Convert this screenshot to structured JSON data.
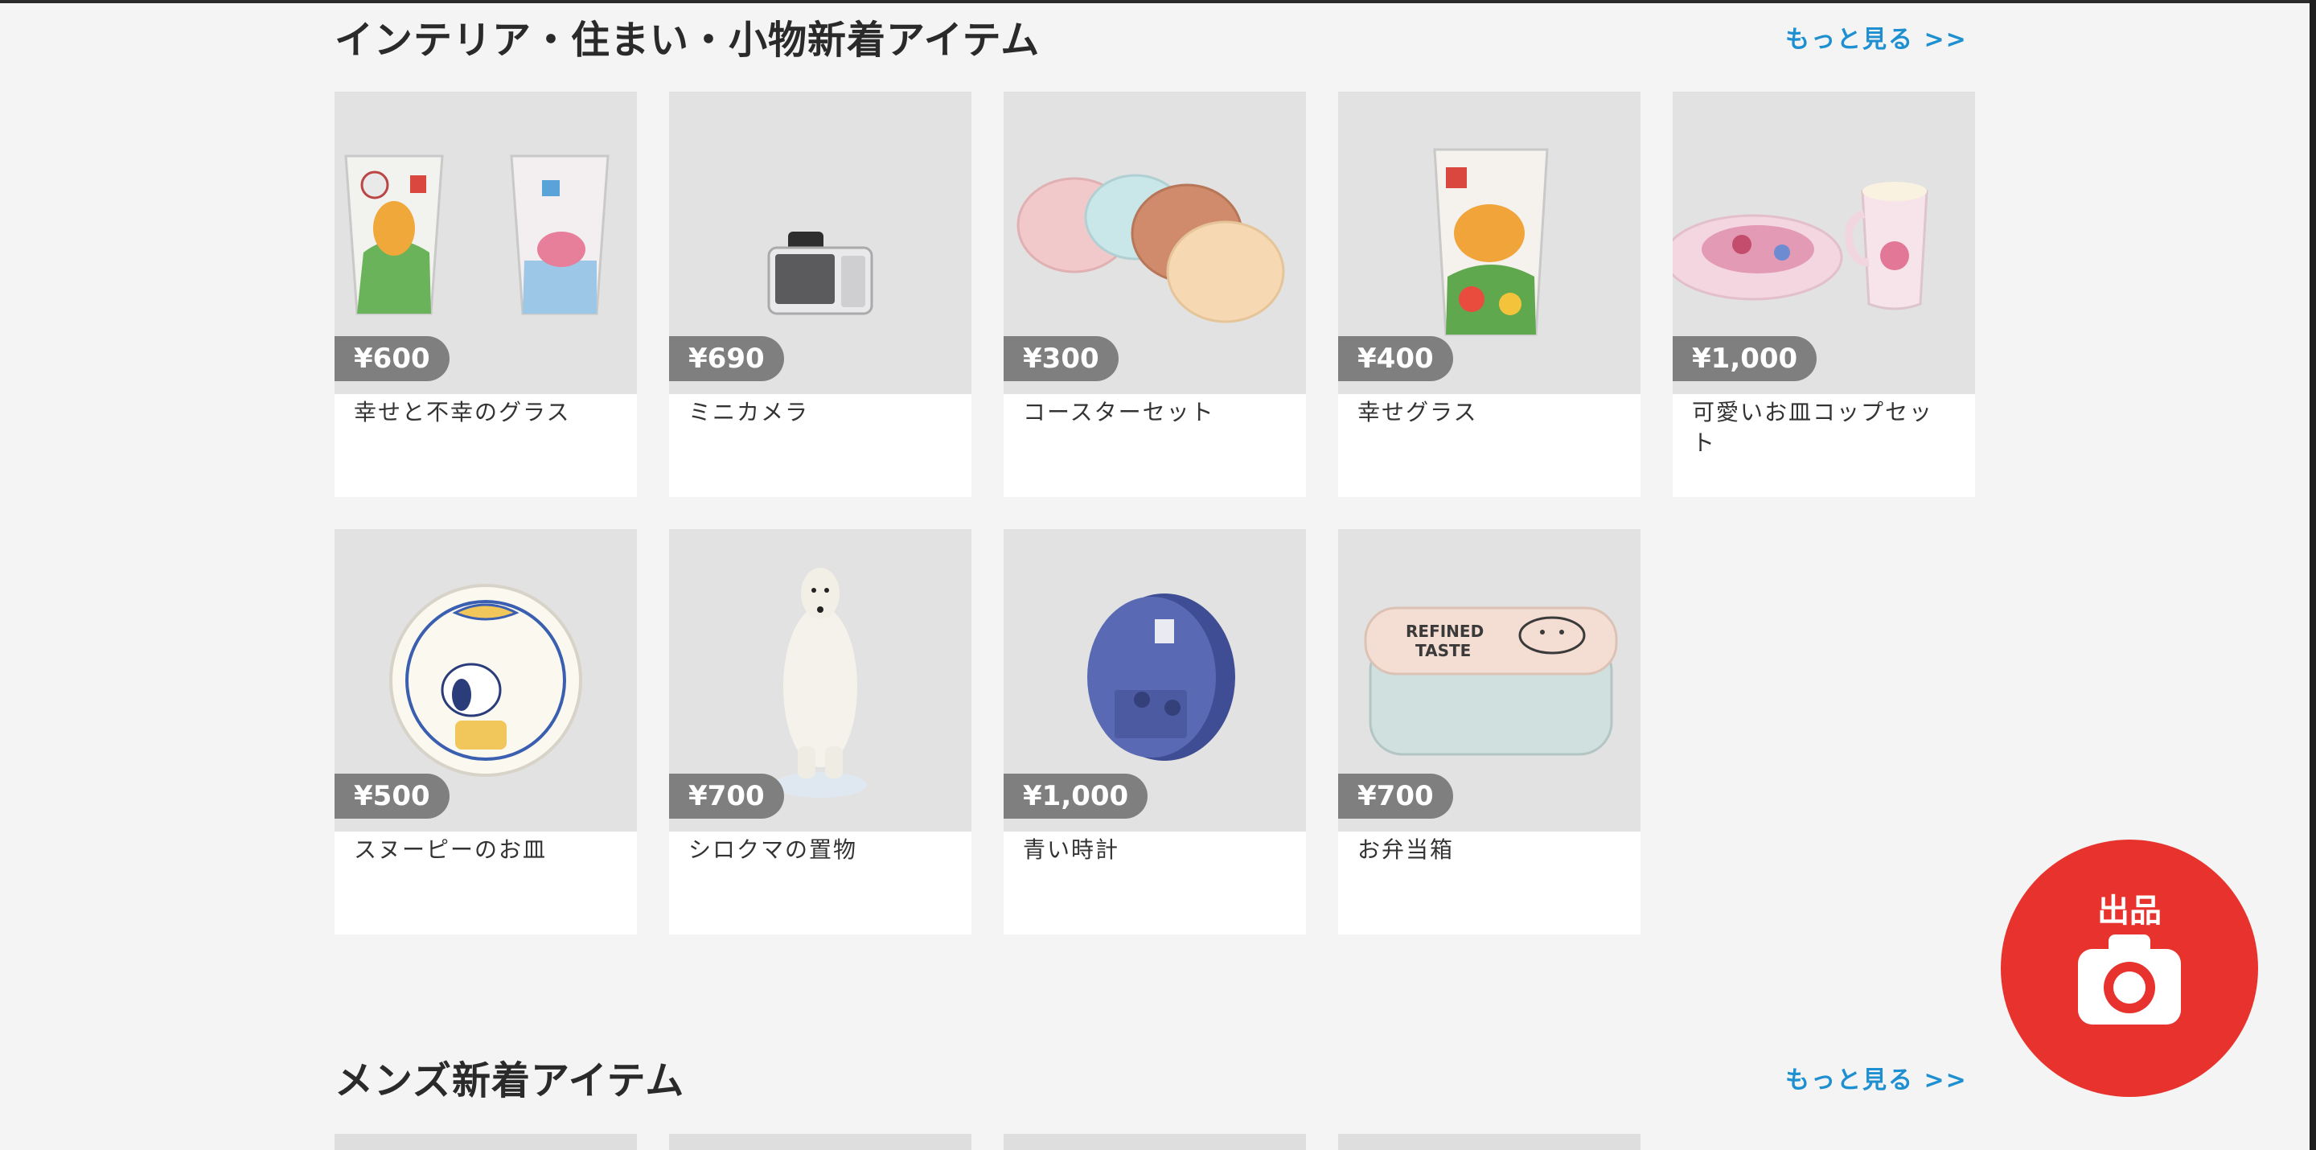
{
  "colors": {
    "accent": "#e8322e",
    "link": "#1e8fd0",
    "price_badge": "#7f7f7f"
  },
  "sections": [
    {
      "title": "インテリア・住まい・小物新着アイテム",
      "more": "もっと見る >>",
      "items": [
        {
          "price": "¥600",
          "name": "幸せと不幸のグラス",
          "image": "glass-pair"
        },
        {
          "price": "¥690",
          "name": "ミニカメラ",
          "image": "mini-camera"
        },
        {
          "price": "¥300",
          "name": "コースターセット",
          "image": "coasters"
        },
        {
          "price": "¥400",
          "name": "幸せグラス",
          "image": "single-glass"
        },
        {
          "price": "¥1,000",
          "name": "可愛いお皿コップセット",
          "image": "plate-cup"
        },
        {
          "price": "¥500",
          "name": "スヌーピーのお皿",
          "image": "snoopy-plate"
        },
        {
          "price": "¥700",
          "name": "シロクマの置物",
          "image": "polar-bear"
        },
        {
          "price": "¥1,000",
          "name": "青い時計",
          "image": "blue-clock"
        },
        {
          "price": "¥700",
          "name": "お弁当箱",
          "image": "bento-box"
        }
      ]
    },
    {
      "title": "メンズ新着アイテム",
      "more": "もっと見る >>"
    }
  ],
  "fab": {
    "label": "出品",
    "icon": "camera-icon"
  },
  "illustration_text": {
    "bento": [
      "REFINED",
      "TASTE"
    ]
  }
}
